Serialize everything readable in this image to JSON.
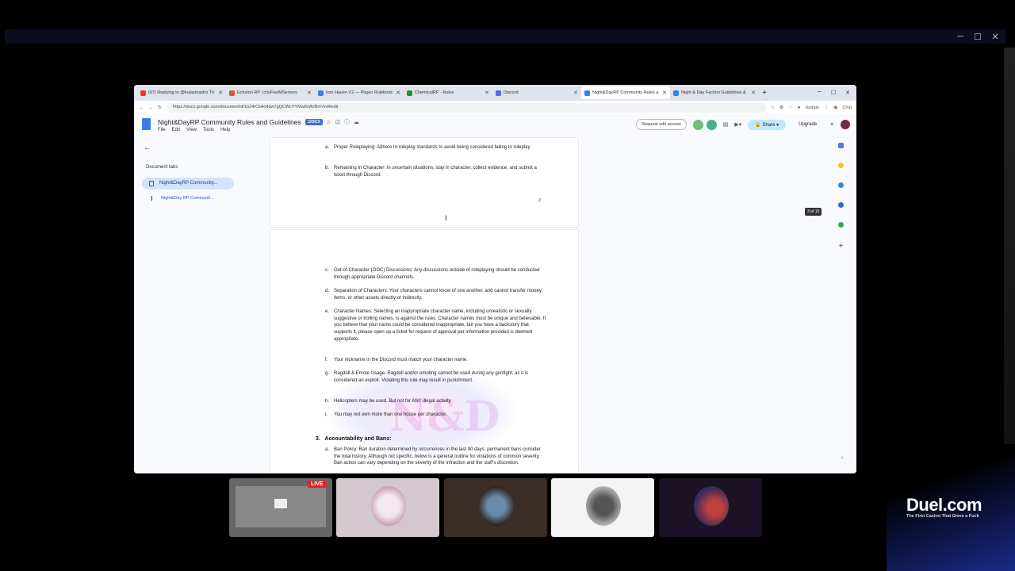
{
  "browser": {
    "tabs": [
      {
        "label": "(97) Replying to @kulasmasho Th",
        "color": "#e33"
      },
      {
        "label": "Echelon RP | cfx/FiveMServers",
        "color": "#e0523c"
      },
      {
        "label": "Iron Haven V2 — Player Rulebook",
        "color": "#3b7ded"
      },
      {
        "label": "ChemicalRP - Rules",
        "color": "#2a8a3a"
      },
      {
        "label": "Discord",
        "color": "#5865f2"
      },
      {
        "label": "Night&DayRP Community Rules a",
        "color": "#3b7ded"
      },
      {
        "label": "Night & Day Faction Guidelines &",
        "color": "#3b7ded"
      }
    ],
    "url": "https://docs.google.com/document/d/1b24rCkAo4dw7gQCWcYYMw8nAVBmVnl4/edit",
    "update_label": "Update",
    "chat_label": "Chat"
  },
  "doc": {
    "title": "Night&DayRP Community Rules and Guidelines",
    "badge": ".DOCX",
    "menu": [
      "File",
      "Edit",
      "View",
      "Tools",
      "Help"
    ],
    "request_edit": "Request edit access",
    "share": "Share",
    "upgrade": "Upgrade"
  },
  "sidebar": {
    "title": "Document tabs",
    "tab1": "Night&DayRP Community...",
    "tab2": "Night&Day RP Communit..."
  },
  "page1": {
    "items": [
      {
        "letter": "a.",
        "text": "Proper Roleplaying: Adhere to roleplay standards to avoid being considered failing to roleplay."
      },
      {
        "letter": "b.",
        "text": "Remaining In Character: In uncertain situations, stay in character, collect evidence, and submit a ticket through Discord."
      }
    ],
    "page_number": "2"
  },
  "page2": {
    "items": [
      {
        "letter": "c.",
        "text": "Out-of-Character (OOC) Discussions: Any discussions outside of roleplaying should be conducted through appropriate Discord channels."
      },
      {
        "letter": "d.",
        "text": "Separation of Characters: Your characters cannot know of one another, and cannot transfer money, items, or other assets directly or indirectly."
      },
      {
        "letter": "e.",
        "text": "Character Names: Selecting an inappropriate character name, including unrealistic or sexually suggestive or trolling names, is against the rules. Character names must be unique and believable. If you believe that your name could be considered inappropriate, but you have a backstory that supports it, please open up a ticket for request of approval per information provided is deemed appropriate."
      },
      {
        "letter": "f.",
        "text": "Your nickname in the Discord must match your character name."
      },
      {
        "letter": "g.",
        "text": "Ragdoll & Emote Usage: Ragdoll and/or emoting cannot be used during any gunfight, as it is considered an exploit. Violating this rule may result in punishment."
      },
      {
        "letter": "h.",
        "text": "Helicopters may be used. But not for ANY illegal activity"
      },
      {
        "letter": "i.",
        "text": "You may not own more than one house per character."
      }
    ],
    "heading": "3.   Accountability and Bans:",
    "ban_item": {
      "letter": "a.",
      "text": "Ban Policy: Ban duration determined by occurrences in the last 90 days; permanent bans consider the total history. Although not specific, below is a general outline for violations of common severity. Ban action can vary depending on the severity of the infraction and the staff's discretion."
    }
  },
  "page_count": "3 of 10",
  "stream": {
    "live_label": "LIVE",
    "duel_logo": "Duel.com",
    "duel_tagline": "The First Casino That Gives a Fuck"
  }
}
